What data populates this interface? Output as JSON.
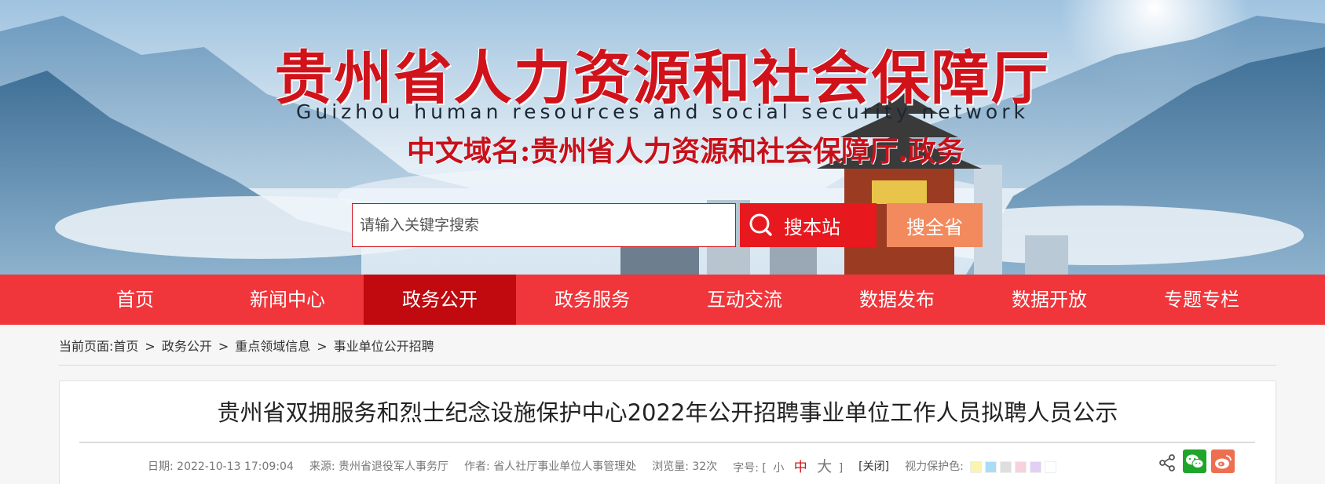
{
  "banner": {
    "title": "贵州省人力资源和社会保障厅",
    "subtitle": "Guizhou human resources and social security network",
    "domain": "中文域名:贵州省人力资源和社会保障厅.政务",
    "search_placeholder": "请输入关键字搜索",
    "search_site_label": "搜本站",
    "search_province_label": "搜全省",
    "colors": {
      "brand_red": "#d0121b",
      "search_site_bg": "#e8181f",
      "search_province_bg": "#f28a5e"
    }
  },
  "nav": {
    "items": [
      "首页",
      "新闻中心",
      "政务公开",
      "政务服务",
      "互动交流",
      "数据发布",
      "数据开放",
      "专题专栏"
    ],
    "active": "政务公开",
    "colors": {
      "bg": "#f0353b",
      "active_bg": "#c00a10"
    }
  },
  "breadcrumb": {
    "prefix": "当前页面:",
    "items": [
      "首页",
      "政务公开",
      "重点领域信息",
      "事业单位公开招聘"
    ],
    "separator": ">"
  },
  "article": {
    "title": "贵州省双拥服务和烈士纪念设施保护中心2022年公开招聘事业单位工作人员拟聘人员公示",
    "meta": {
      "date_label": "日期:",
      "date": "2022-10-13 17:09:04",
      "source_label": "来源:",
      "source": "贵州省退役军人事务厅",
      "author_label": "作者:",
      "author": "省人社厅事业单位人事管理处",
      "views_label": "浏览量:",
      "views": "32次",
      "fontsize_label": "字号:",
      "fontsize_open": "[",
      "fontsize_small": "小",
      "fontsize_medium": "中",
      "fontsize_large": "大",
      "fontsize_close": "]",
      "close_label": "[关闭]",
      "eye_protection_label": "视力保护色:",
      "eye_colors": [
        "#f9f5b0",
        "#a9dcf5",
        "#dedede",
        "#f7d2dd",
        "#e2cff5",
        "#ffffff"
      ]
    },
    "share_icons": [
      "share-icon",
      "wechat-icon",
      "weibo-icon"
    ]
  }
}
